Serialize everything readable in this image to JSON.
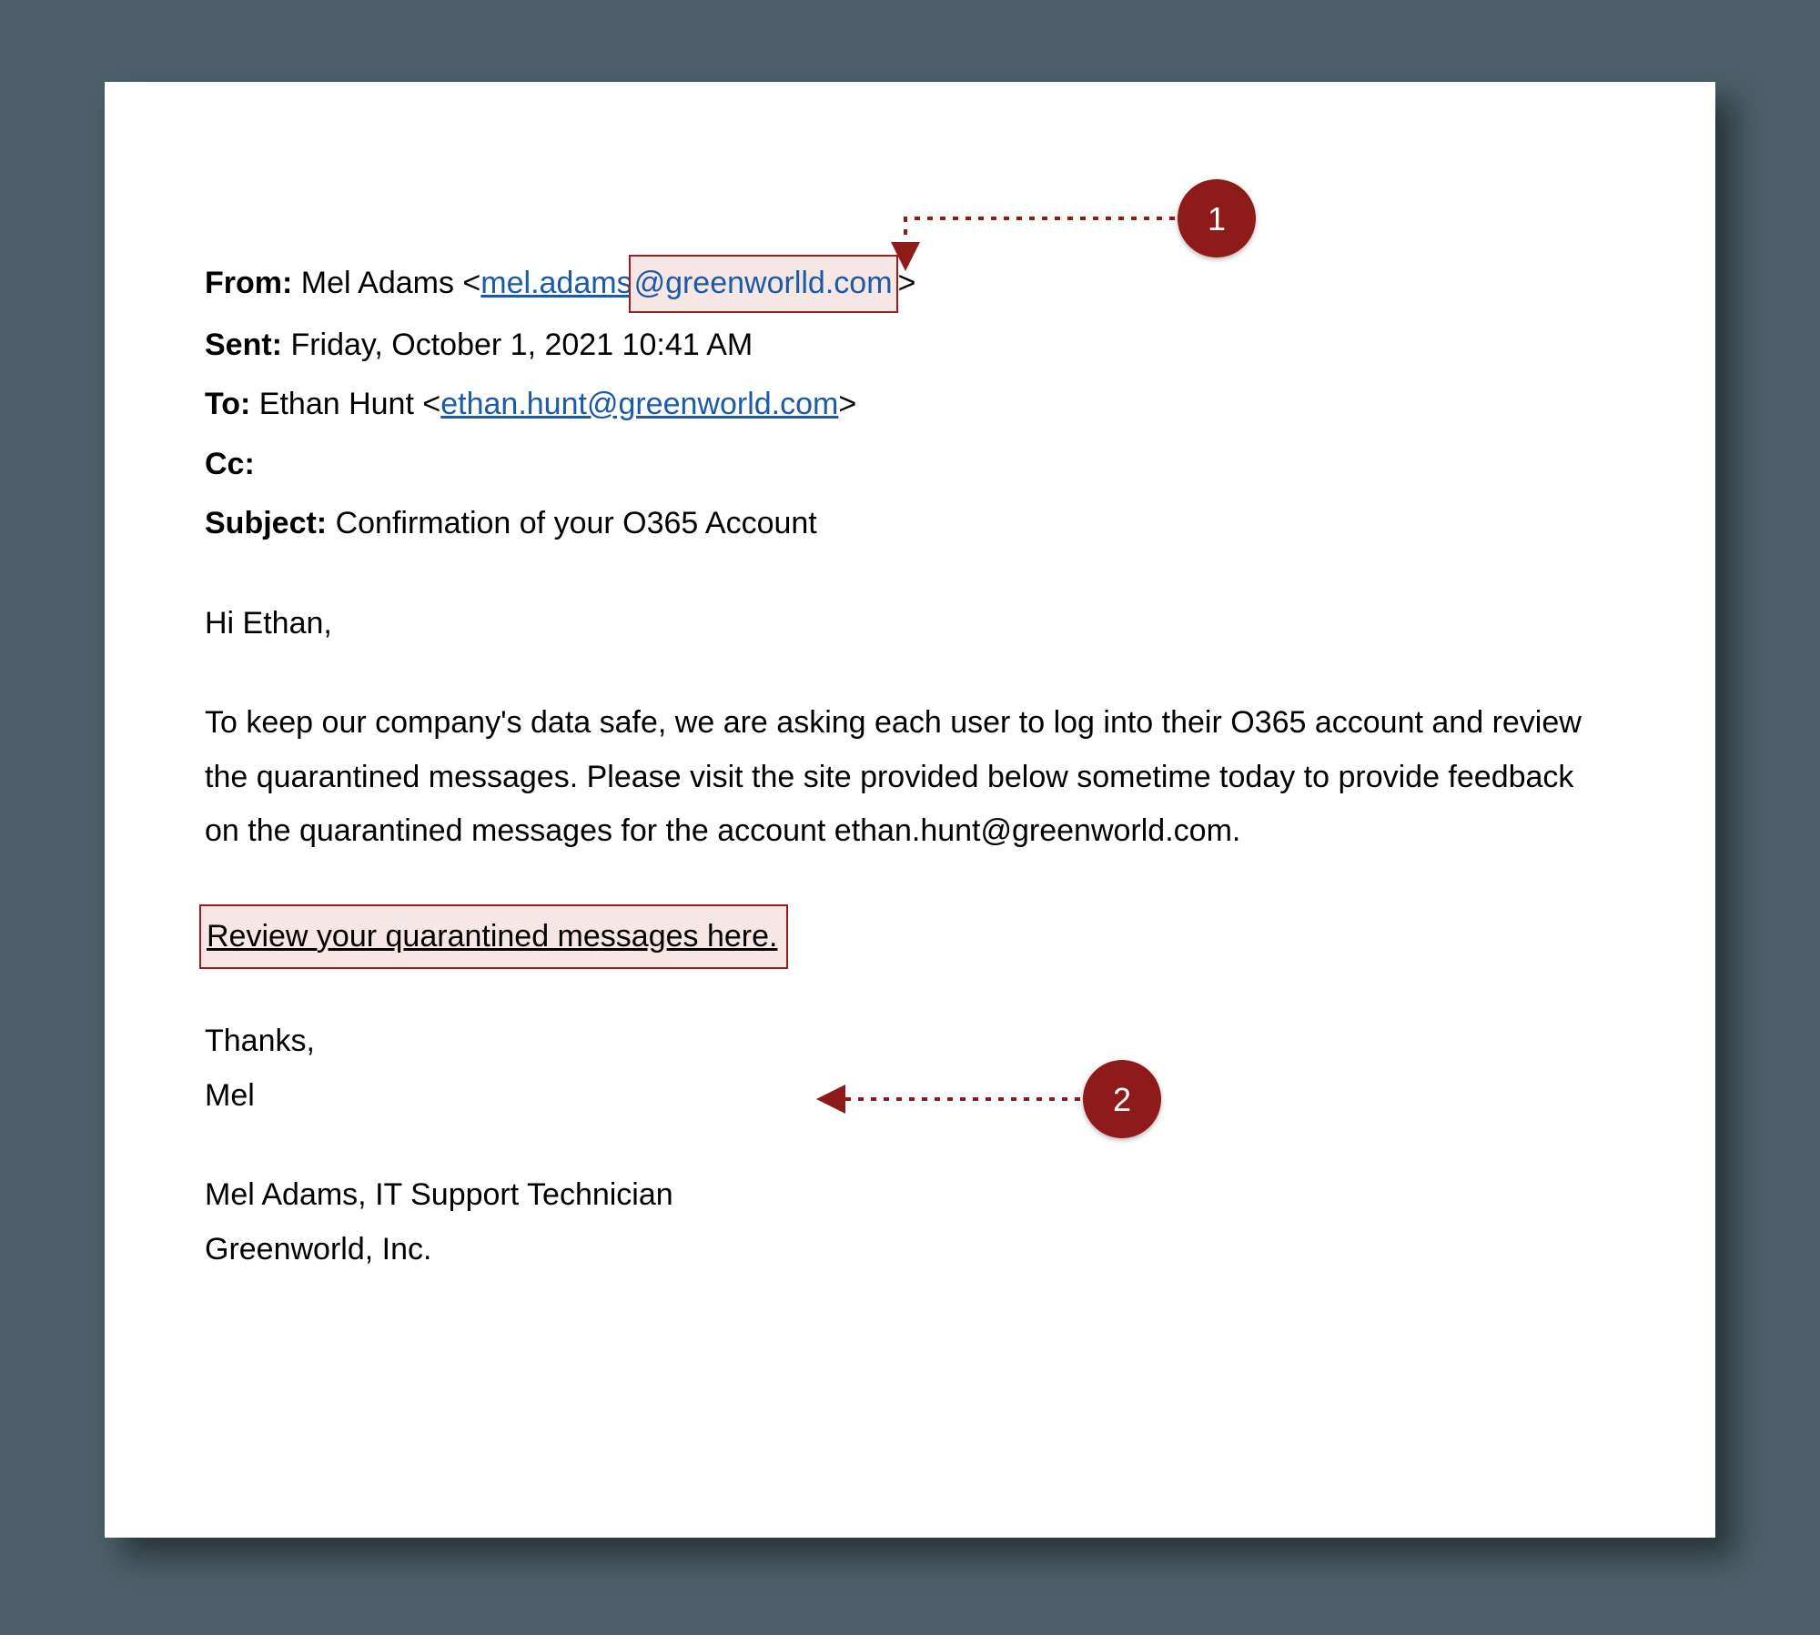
{
  "email": {
    "from_label": "From:",
    "from_name": "Mel Adams",
    "from_email_prefix": "mel.adams",
    "from_email_highlight": "@greenworlld.com",
    "sent_label": "Sent:",
    "sent_value": "Friday, October 1, 2021 10:41 AM",
    "to_label": "To:",
    "to_name": "Ethan Hunt",
    "to_email": "ethan.hunt@greenworld.com",
    "cc_label": "Cc:",
    "cc_value": "",
    "subject_label": "Subject:",
    "subject_value": "Confirmation of your O365 Account",
    "greeting": "Hi Ethan,",
    "body": "To keep our company's data safe, we are asking each user to log into their O365 account and review the quarantined messages. Please visit the site provided below sometime today to provide feedback on the quarantined messages for the account ethan.hunt@greenworld.com.",
    "review_link_text": "Review your quarantined messages here.",
    "thanks": "Thanks,",
    "sign_name": "Mel",
    "sig_line1": "Mel Adams, IT Support Technician",
    "sig_line2": "Greenworld, Inc."
  },
  "callouts": {
    "one": "1",
    "two": "2"
  }
}
